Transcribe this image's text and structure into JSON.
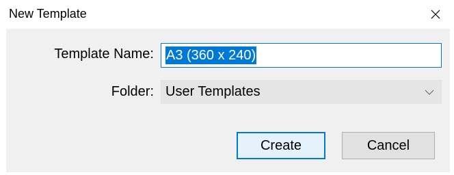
{
  "dialog": {
    "title": "New Template",
    "close_icon": "close-icon"
  },
  "form": {
    "template_name_label": "Template Name:",
    "template_name_value": "A3 (360 x 240)",
    "folder_label": "Folder:",
    "folder_value": "User Templates",
    "folder_dropdown_icon": "chevron-down-icon"
  },
  "buttons": {
    "create_label": "Create",
    "cancel_label": "Cancel"
  },
  "colors": {
    "accent": "#0078d7",
    "panel_background": "#f0f0f0",
    "selection_text": "#ffffff"
  }
}
